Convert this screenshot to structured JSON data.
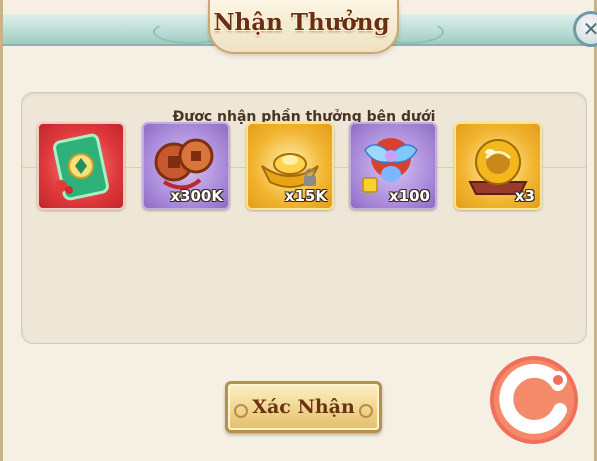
{
  "dialog": {
    "title": "Nhận Thưởng",
    "subtitle": "Được nhận phần thưởng bên dưới",
    "close_icon": "close-icon"
  },
  "rewards": [
    {
      "icon": "green-card-icon",
      "quality": "red",
      "qty": ""
    },
    {
      "icon": "copper-coins-icon",
      "quality": "purple",
      "qty": "x300K"
    },
    {
      "icon": "locked-gold-ingot-icon",
      "quality": "gold",
      "qty": "x15K"
    },
    {
      "icon": "fairy-pet-fragment-icon",
      "quality": "purple",
      "qty": "x100"
    },
    {
      "icon": "golden-orb-icon",
      "quality": "gold",
      "qty": "x3"
    }
  ],
  "confirm_button": {
    "label": "Xác Nhận"
  },
  "colors": {
    "title_text": "#6a2e14",
    "header_teal": "#b9dcd4",
    "quality_red": "#e0393d",
    "quality_purple": "#a98bd9",
    "quality_gold": "#f2b531",
    "logo": "#f07a5a"
  }
}
